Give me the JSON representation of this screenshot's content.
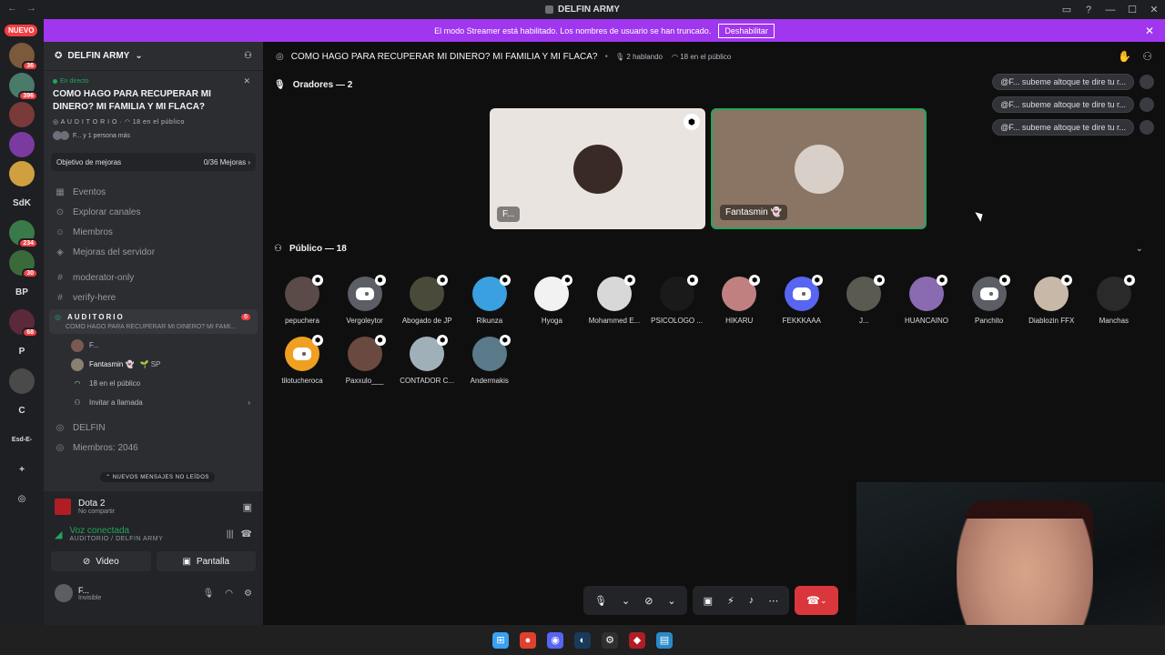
{
  "window": {
    "title": "DELFIN ARMY"
  },
  "banner": {
    "text": "El modo Streamer está habilitado. Los nombres de usuario se han truncado.",
    "button": "Deshabilitar"
  },
  "rail": {
    "new_label": "NUEVO",
    "items": [
      {
        "label": "",
        "badge": "36",
        "color": "#7a5a3a"
      },
      {
        "label": "",
        "badge": "396",
        "color": "#4a7a6a"
      },
      {
        "label": "",
        "badge": "",
        "color": "#7a3a3a"
      },
      {
        "label": "",
        "badge": "",
        "color": "#7a3aa0"
      },
      {
        "label": "",
        "badge": "",
        "color": "#d0a040"
      },
      {
        "label": "SdK",
        "badge": "",
        "color": "#1e1f22"
      },
      {
        "label": "",
        "badge": "234",
        "color": "#3a7a4a"
      },
      {
        "label": "",
        "badge": "30",
        "color": "#3a6a3a"
      },
      {
        "label": "BP",
        "badge": "",
        "color": "#1e1f22"
      },
      {
        "label": "",
        "badge": "68",
        "color": "#5a2a3a"
      },
      {
        "label": "P",
        "badge": "",
        "color": "#1e1f22"
      },
      {
        "label": "",
        "badge": "",
        "color": "#4a4a4a"
      },
      {
        "label": "C",
        "badge": "",
        "color": "#1e1f22"
      },
      {
        "label": "Esd-E-",
        "badge": "",
        "color": "#1e1f22"
      },
      {
        "label": "+",
        "badge": "",
        "color": "#1e1f22"
      },
      {
        "label": "◎",
        "badge": "",
        "color": "#1e1f22"
      }
    ]
  },
  "sidebar": {
    "server_name": "DELFIN ARMY",
    "live": {
      "tag": "En directo",
      "title": "COMO HAGO PARA RECUPERAR MI DINERO? MI FAMILIA Y MI FLACA?",
      "meta": "AUDITORIO · 18 en el público",
      "meta_stage": "A U D I T O R I O",
      "meta_count": "18 en el público",
      "people": "F... y 1 persona más"
    },
    "goal": {
      "label": "Objetivo de mejoras",
      "value": "0/36 Mejoras"
    },
    "nav": [
      {
        "icon": "calendar-icon",
        "glyph": "▦",
        "label": "Eventos"
      },
      {
        "icon": "compass-icon",
        "glyph": "⊙",
        "label": "Explorar canales"
      },
      {
        "icon": "members-icon",
        "glyph": "☺",
        "label": "Miembros"
      },
      {
        "icon": "boost-icon",
        "glyph": "◈",
        "label": "Mejoras del servidor"
      }
    ],
    "channels": [
      {
        "label": "moderator-only"
      },
      {
        "label": "verify-here"
      }
    ],
    "stage": {
      "name": "AUDITORIO",
      "topic": "COMO HAGO PARA RECUPERAR MI DINERO? MI FAMI...",
      "badge": "6",
      "members": [
        {
          "name": "F..."
        },
        {
          "name": "Fantasmin 👻",
          "extra": "SP"
        }
      ],
      "audience": "18 en el público",
      "invite": "Invitar a llamada"
    },
    "channels2": [
      {
        "label": "DELFIN"
      },
      {
        "label": "Miembros: 2046"
      }
    ],
    "unread": "NUEVOS MENSAJES NO LEÍDOS",
    "game": {
      "name": "Dota 2",
      "sub": "No compartir"
    },
    "voice": {
      "status": "Voz conectada",
      "location": "AUDITORIO / DELFIN ARMY"
    },
    "video_label": "Video",
    "screen_label": "Pantalla",
    "user": {
      "name": "F...",
      "status": "Invisible"
    }
  },
  "main": {
    "topic": "COMO HAGO PARA RECUPERAR MI DINERO? MI FAMILIA Y MI FLACA?",
    "speaking": "2 hablando",
    "audience": "18 en el público",
    "speakers_title": "Oradores — 2",
    "audience_title": "Público — 18",
    "speakers": [
      {
        "name": "F...",
        "bg": "#e9e4e0",
        "avatar": "#3a2a25"
      },
      {
        "name": "Fantasmin 👻",
        "bg": "#8a7565",
        "avatar": "#d8d0c8"
      }
    ],
    "chats": [
      {
        "text": "@F... subeme altoque te dire tu r..."
      },
      {
        "text": "@F... subeme altoque te dire tu r..."
      },
      {
        "text": "@F... subeme altoque te dire tu r..."
      }
    ],
    "audience_list": [
      {
        "name": "pepuchera",
        "color": "#5a4a48",
        "discord": false
      },
      {
        "name": "Vergoleytor",
        "color": "#5c5e66",
        "discord": true
      },
      {
        "name": "Abogado de JP",
        "color": "#4a4a3a",
        "discord": false
      },
      {
        "name": "Rikunza",
        "color": "#3aa0e0",
        "discord": false
      },
      {
        "name": "Hyoga",
        "color": "#f2f2f2",
        "discord": false
      },
      {
        "name": "Mohammed E...",
        "color": "#d8d8d8",
        "discord": false
      },
      {
        "name": "PSICOLOGO ...",
        "color": "#1a1a1a",
        "discord": false
      },
      {
        "name": "HIKARU",
        "color": "#c08080",
        "discord": false
      },
      {
        "name": "FEKKKAAA",
        "color": "#5865f2",
        "discord": true
      },
      {
        "name": "J...",
        "color": "#5a5a50",
        "discord": false
      },
      {
        "name": "HUANCAINO",
        "color": "#8a6ab0",
        "discord": false
      },
      {
        "name": "Panchito",
        "color": "#5c5e66",
        "discord": true
      },
      {
        "name": "Diablozin FFX",
        "color": "#c8b8a8",
        "discord": false
      },
      {
        "name": "Manchas",
        "color": "#2a2a2a",
        "discord": false
      },
      {
        "name": "tilotucheroca",
        "color": "#f0a020",
        "discord": true
      },
      {
        "name": "Paxxulo___",
        "color": "#6a4a40",
        "discord": false
      },
      {
        "name": "CONTADOR C...",
        "color": "#a0b0b8",
        "discord": false
      },
      {
        "name": "Andermakis",
        "color": "#5a7a8a",
        "discord": false
      }
    ]
  },
  "taskbar": {
    "apps": [
      {
        "icon": "windows-icon",
        "glyph": "⊞",
        "color": "#3aa0f0"
      },
      {
        "icon": "chrome-icon",
        "glyph": "●",
        "color": "#e04030"
      },
      {
        "icon": "discord-icon",
        "glyph": "◉",
        "color": "#5865f2"
      },
      {
        "icon": "steam-icon",
        "glyph": "◐",
        "color": "#1a3a5a"
      },
      {
        "icon": "settings-icon",
        "glyph": "⚙",
        "color": "#303030"
      },
      {
        "icon": "dota-icon",
        "glyph": "◆",
        "color": "#b01d24"
      },
      {
        "icon": "notepad-icon",
        "glyph": "▤",
        "color": "#2a8ac8"
      }
    ]
  }
}
